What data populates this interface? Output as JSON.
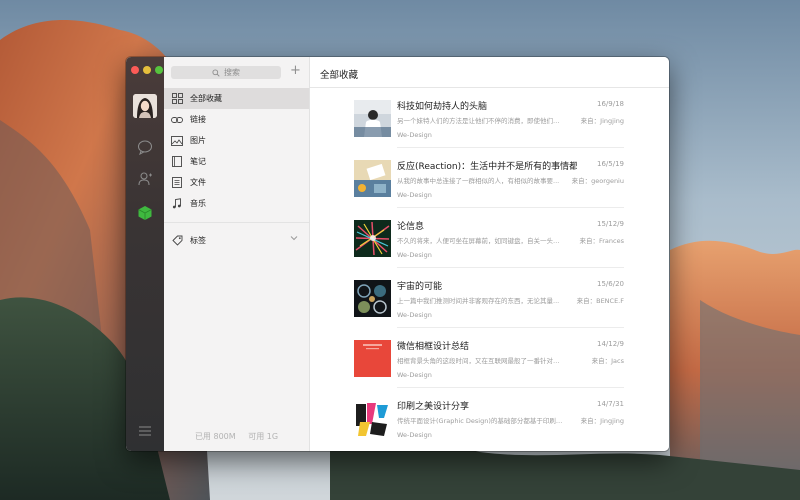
{
  "window": {
    "sidebar": {
      "search_placeholder": "搜索",
      "add_label": "+",
      "items": [
        {
          "label": "全部收藏",
          "icon": "grid-icon"
        },
        {
          "label": "链接",
          "icon": "link-icon"
        },
        {
          "label": "图片",
          "icon": "image-icon"
        },
        {
          "label": "笔记",
          "icon": "note-icon"
        },
        {
          "label": "文件",
          "icon": "file-icon"
        },
        {
          "label": "音乐",
          "icon": "music-icon"
        }
      ],
      "tags_label": "标签",
      "storage": {
        "used": "已用 800M",
        "available": "可用 1G"
      }
    },
    "main": {
      "title": "全部收藏",
      "items": [
        {
          "title": "科技如何劫持人的头脑",
          "date": "16/9/18",
          "desc": "另一个妹特人们的方法是让他们不停的消费，即使他们没...",
          "from": "来自：Jingjing",
          "source": "We-Design"
        },
        {
          "title": "反应(Reaction)：生活中并不是所有的事情都那...",
          "date": "16/5/19",
          "desc": "从我的故事中总连接了一群相似的人，有相似的故事要...",
          "from": "来自：georgeniu",
          "source": "We-Design"
        },
        {
          "title": "论信息",
          "date": "15/12/9",
          "desc": "不久的将来，人便可坐在屏幕前，如同键盘，自关一头每...",
          "from": "来自：Frances",
          "source": "We-Design"
        },
        {
          "title": "宇宙的可能",
          "date": "15/6/20",
          "desc": "上一篇中我们推测时间并非客观存在的东西，无论其量...",
          "from": "来自：BENCE.F",
          "source": "We-Design"
        },
        {
          "title": "微信相框设计总结",
          "date": "14/12/9",
          "desc": "相框背景头角的这段时间，又在互联网最般了一番针对大...",
          "from": "来自：Jacs",
          "source": "We-Design"
        },
        {
          "title": "印刷之美设计分享",
          "date": "14/7/31",
          "desc": "传统平面设计(Graphic Design)的基础部分都基于印刷的设...",
          "from": "来自：Jingjing",
          "source": "We-Design"
        }
      ]
    }
  },
  "colors": {
    "close": "#fc5b57",
    "minimize": "#e5bf3c",
    "maximize": "#56c43e",
    "favorites_accent": "#3fb93f"
  }
}
